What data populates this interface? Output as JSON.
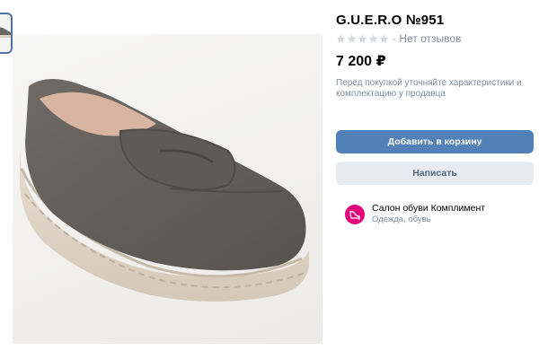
{
  "product": {
    "title": "G.U.E.R.O №951",
    "reviews_text": "· Нет отзывов",
    "stars_filled": 0,
    "stars_total": 5,
    "price": "7 200 ₽",
    "note": "Перед покупкой уточняйте характеристики и комплектацию у продавца",
    "image": "suede-loafer-photo"
  },
  "actions": {
    "add_to_cart": "Добавить в корзину",
    "message": "Написать"
  },
  "seller": {
    "name": "Салон обуви Комплимент",
    "category": "Одежда, обувь",
    "avatar_color": "#e4007b"
  },
  "colors": {
    "primary_button": "#5181b8",
    "secondary_button": "#e5ebf1",
    "muted_text": "#818c99",
    "star_empty": "#d5d9de"
  }
}
